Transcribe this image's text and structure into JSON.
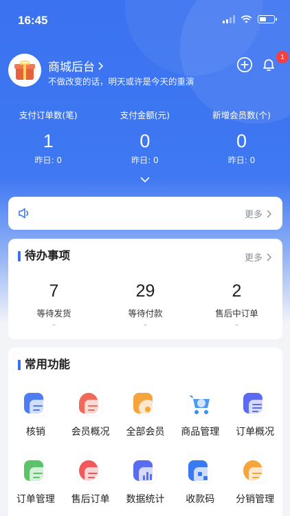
{
  "status_bar": {
    "time": "16:45"
  },
  "header": {
    "store_name": "商城后台",
    "slogan": "不做改变的话，明天或许是今天的重演",
    "notification_count": "1"
  },
  "stats": [
    {
      "label": "支付订单数(笔)",
      "value": "1",
      "yesterday": "昨日: 0"
    },
    {
      "label": "支付金额(元)",
      "value": "0",
      "yesterday": "昨日: 0"
    },
    {
      "label": "新增会员数(个)",
      "value": "0",
      "yesterday": "昨日: 0"
    }
  ],
  "notice": {
    "more_label": "更多"
  },
  "todo": {
    "title": "待办事项",
    "more_label": "更多",
    "items": [
      {
        "value": "7",
        "label": "等待发货",
        "dash": "–"
      },
      {
        "value": "29",
        "label": "等待付款",
        "dash": "–"
      },
      {
        "value": "2",
        "label": "售后中订单",
        "dash": "–"
      }
    ]
  },
  "functions": {
    "title": "常用功能",
    "items": [
      {
        "label": "核销",
        "icon": "verify-icon",
        "color": "#4f7cf0"
      },
      {
        "label": "会员概况",
        "icon": "member-overview-icon",
        "color": "#f06a5a"
      },
      {
        "label": "全部会员",
        "icon": "all-members-icon",
        "color": "#f5a53c"
      },
      {
        "label": "商品管理",
        "icon": "cart-icon",
        "color": "#3a8ef0"
      },
      {
        "label": "订单概况",
        "icon": "order-overview-icon",
        "color": "#5b6cf0"
      },
      {
        "label": "订单管理",
        "icon": "order-manage-icon",
        "color": "#5cc36a"
      },
      {
        "label": "售后订单",
        "icon": "after-sale-icon",
        "color": "#f05a5a"
      },
      {
        "label": "数据统计",
        "icon": "stats-icon",
        "color": "#5a6cf0"
      },
      {
        "label": "收款码",
        "icon": "payment-code-icon",
        "color": "#3a7af0"
      },
      {
        "label": "分销管理",
        "icon": "distribution-icon",
        "color": "#f5a53c"
      }
    ]
  }
}
